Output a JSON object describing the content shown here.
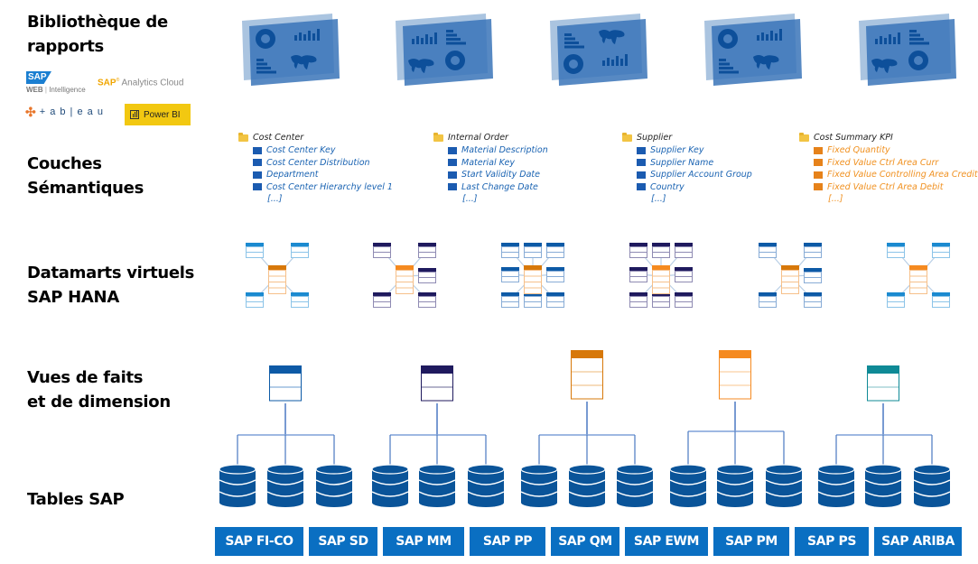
{
  "layers": [
    {
      "id": "reports",
      "label_line1": "Bibliothèque de",
      "label_line2": "rapports"
    },
    {
      "id": "semantic",
      "label_line1": "Couches",
      "label_line2": "Sémantiques"
    },
    {
      "id": "datamarts",
      "label_line1": "Datamarts virtuels",
      "label_line2": "SAP HANA"
    },
    {
      "id": "views",
      "label_line1": "Vues de faits",
      "label_line2": "et de dimension"
    },
    {
      "id": "tables",
      "label_line1": "Tables SAP",
      "label_line2": ""
    }
  ],
  "tools": {
    "webi_brand": "SAP",
    "webi_web": "WEB",
    "webi_intelligence": "Intelligence",
    "sac_brand": "SAP",
    "sac_name": "Analytics Cloud",
    "tableau": "+ a b | e a u",
    "powerbi": "Power BI"
  },
  "dashboards": [
    {
      "variant": "donut-bars-hbars-map"
    },
    {
      "variant": "bars-hbars-map-donut"
    },
    {
      "variant": "hbars-map-donut-bars"
    },
    {
      "variant": "donut-bars-hbars-map"
    },
    {
      "variant": "bars-hbars-map-donut"
    }
  ],
  "semantic_groups": [
    {
      "title": "Cost Center",
      "kind": "dimension",
      "items": [
        "Cost Center Key",
        "Cost Center Distribution",
        "Department",
        "Cost Center Hierarchy level 1"
      ],
      "more": "[...]"
    },
    {
      "title": "Internal Order",
      "kind": "dimension",
      "items": [
        "Material Description",
        "Material Key",
        "Start Validity Date",
        "Last Change Date"
      ],
      "more": "[...]"
    },
    {
      "title": "Supplier",
      "kind": "dimension",
      "items": [
        "Supplier Key",
        "Supplier Name",
        "Supplier Account Group",
        "Country"
      ],
      "more": "[...]"
    },
    {
      "title": "Cost Summary KPI",
      "kind": "kpi",
      "items": [
        "Fixed Quantity",
        "Fixed Value Ctrl Area Curr",
        "Fixed Value Controlling Area Credit",
        "Fixed Value Ctrl Area Debit"
      ],
      "more": "[...]"
    }
  ],
  "colors": {
    "blue": "#1b8ad0",
    "dark_blue": "#0d5aa6",
    "navy": "#1f1a5e",
    "orange": "#d7780a",
    "light_orange": "#f58a20",
    "teal": "#0f8a96",
    "db_blue": "#0a5499",
    "button_blue": "#0a6fc2"
  },
  "datamarts": [
    {
      "satellite_color": "#1b8ad0",
      "layout": "4-corner"
    },
    {
      "satellite_color": "#1f1a5e",
      "layout": "5-right"
    },
    {
      "satellite_color": "#0d5aa6",
      "layout": "8-grid"
    },
    {
      "satellite_color": "#1f1a5e",
      "layout": "8-grid"
    },
    {
      "satellite_color": "#0d5aa6",
      "layout": "5-right"
    },
    {
      "satellite_color": "#1b8ad0",
      "layout": "4-corner"
    }
  ],
  "views": [
    {
      "color": "#0d5aa6",
      "rows": 2
    },
    {
      "color": "#1f1a5e",
      "rows": 2
    },
    {
      "color": "#d7780a",
      "rows": 3
    },
    {
      "color": "#f58a20",
      "rows": 3
    },
    {
      "color": "#0f8a96",
      "rows": 2
    }
  ],
  "sap_modules": [
    "SAP FI-CO",
    "SAP SD",
    "SAP MM",
    "SAP PP",
    "SAP QM",
    "SAP EWM",
    "SAP PM",
    "SAP PS",
    "SAP ARIBA"
  ]
}
